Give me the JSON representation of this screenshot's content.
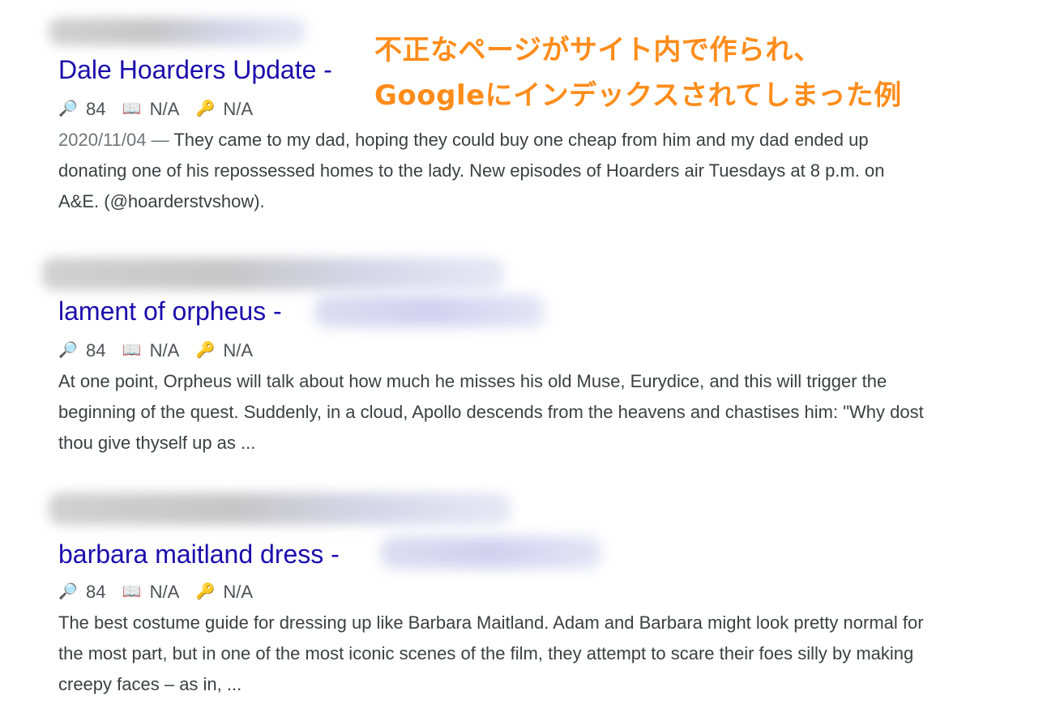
{
  "annotation": {
    "line1": "不正なページがサイト内で作られ、",
    "line2": "Googleにインデックスされてしまった例"
  },
  "results": [
    {
      "title": "Dale Hoarders Update -",
      "stats": {
        "search": "84",
        "book": "N/A",
        "key": "N/A"
      },
      "date": "2020/11/04 — ",
      "snippet": "They came to my dad, hoping they could buy one cheap from him and my dad ended up donating one of his repossessed homes to the lady. New episodes of Hoarders air Tuesdays at 8 p.m. on A&E. (@hoarderstvshow)."
    },
    {
      "title": "lament of orpheus -",
      "stats": {
        "search": "84",
        "book": "N/A",
        "key": "N/A"
      },
      "snippet": "At one point, Orpheus will talk about how much he misses his old Muse, Eurydice, and this will trigger the beginning of the quest. Suddenly, in a cloud, Apollo descends from the heavens and chastises him: \"Why dost thou give thyself up as ..."
    },
    {
      "title": "barbara maitland dress -",
      "stats": {
        "search": "84",
        "book": "N/A",
        "key": "N/A"
      },
      "snippet": "The best costume guide for dressing up like Barbara Maitland. Adam and Barbara might look pretty normal for the most part, but in one of the most iconic scenes of the film, they attempt to scare their foes silly by making creepy faces – as in, ..."
    }
  ],
  "icons": {
    "search": "magnifier-icon",
    "book": "book-icon",
    "key": "key-icon"
  },
  "colors": {
    "title": "#1a0dab",
    "annotation": "#ff8c1a"
  }
}
